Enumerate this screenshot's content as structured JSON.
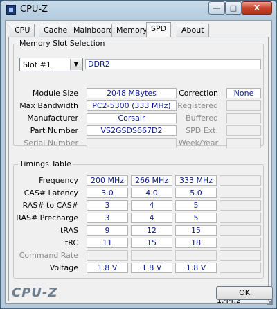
{
  "window": {
    "title": "CPU-Z",
    "brand": "CPU-Z",
    "ok_label": "OK",
    "version": "Version 1.44.2"
  },
  "controls": {
    "min": "—",
    "max": "□",
    "close": "X"
  },
  "tabs": [
    "CPU",
    "Cache",
    "Mainboard",
    "Memory",
    "SPD",
    "About"
  ],
  "active_tab": "SPD",
  "slot": {
    "group_title": "Memory Slot Selection",
    "selected": "Slot #1",
    "type": "DDR2",
    "module_size_label": "Module Size",
    "module_size": "2048 MBytes",
    "max_bandwidth_label": "Max Bandwidth",
    "max_bandwidth": "PC2-5300 (333 MHz)",
    "manufacturer_label": "Manufacturer",
    "manufacturer": "Corsair",
    "part_number_label": "Part Number",
    "part_number": "VS2GSDS667D2",
    "serial_number_label": "Serial Number",
    "serial_number": "",
    "correction_label": "Correction",
    "correction": "None",
    "registered_label": "Registered",
    "registered": "",
    "buffered_label": "Buffered",
    "buffered": "",
    "spd_ext_label": "SPD Ext.",
    "spd_ext": "",
    "week_year_label": "Week/Year",
    "week_year": ""
  },
  "timings": {
    "group_title": "Timings Table",
    "rows": [
      {
        "label": "Frequency",
        "values": [
          "200 MHz",
          "266 MHz",
          "333 MHz",
          ""
        ],
        "disabled": false
      },
      {
        "label": "CAS# Latency",
        "values": [
          "3.0",
          "4.0",
          "5.0",
          ""
        ],
        "disabled": false
      },
      {
        "label": "RAS# to CAS#",
        "values": [
          "3",
          "4",
          "5",
          ""
        ],
        "disabled": false
      },
      {
        "label": "RAS# Precharge",
        "values": [
          "3",
          "4",
          "5",
          ""
        ],
        "disabled": false
      },
      {
        "label": "tRAS",
        "values": [
          "9",
          "12",
          "15",
          ""
        ],
        "disabled": false
      },
      {
        "label": "tRC",
        "values": [
          "11",
          "15",
          "18",
          ""
        ],
        "disabled": false
      },
      {
        "label": "Command Rate",
        "values": [
          "",
          "",
          "",
          ""
        ],
        "disabled": true
      },
      {
        "label": "Voltage",
        "values": [
          "1.8 V",
          "1.8 V",
          "1.8 V",
          ""
        ],
        "disabled": false
      }
    ]
  }
}
